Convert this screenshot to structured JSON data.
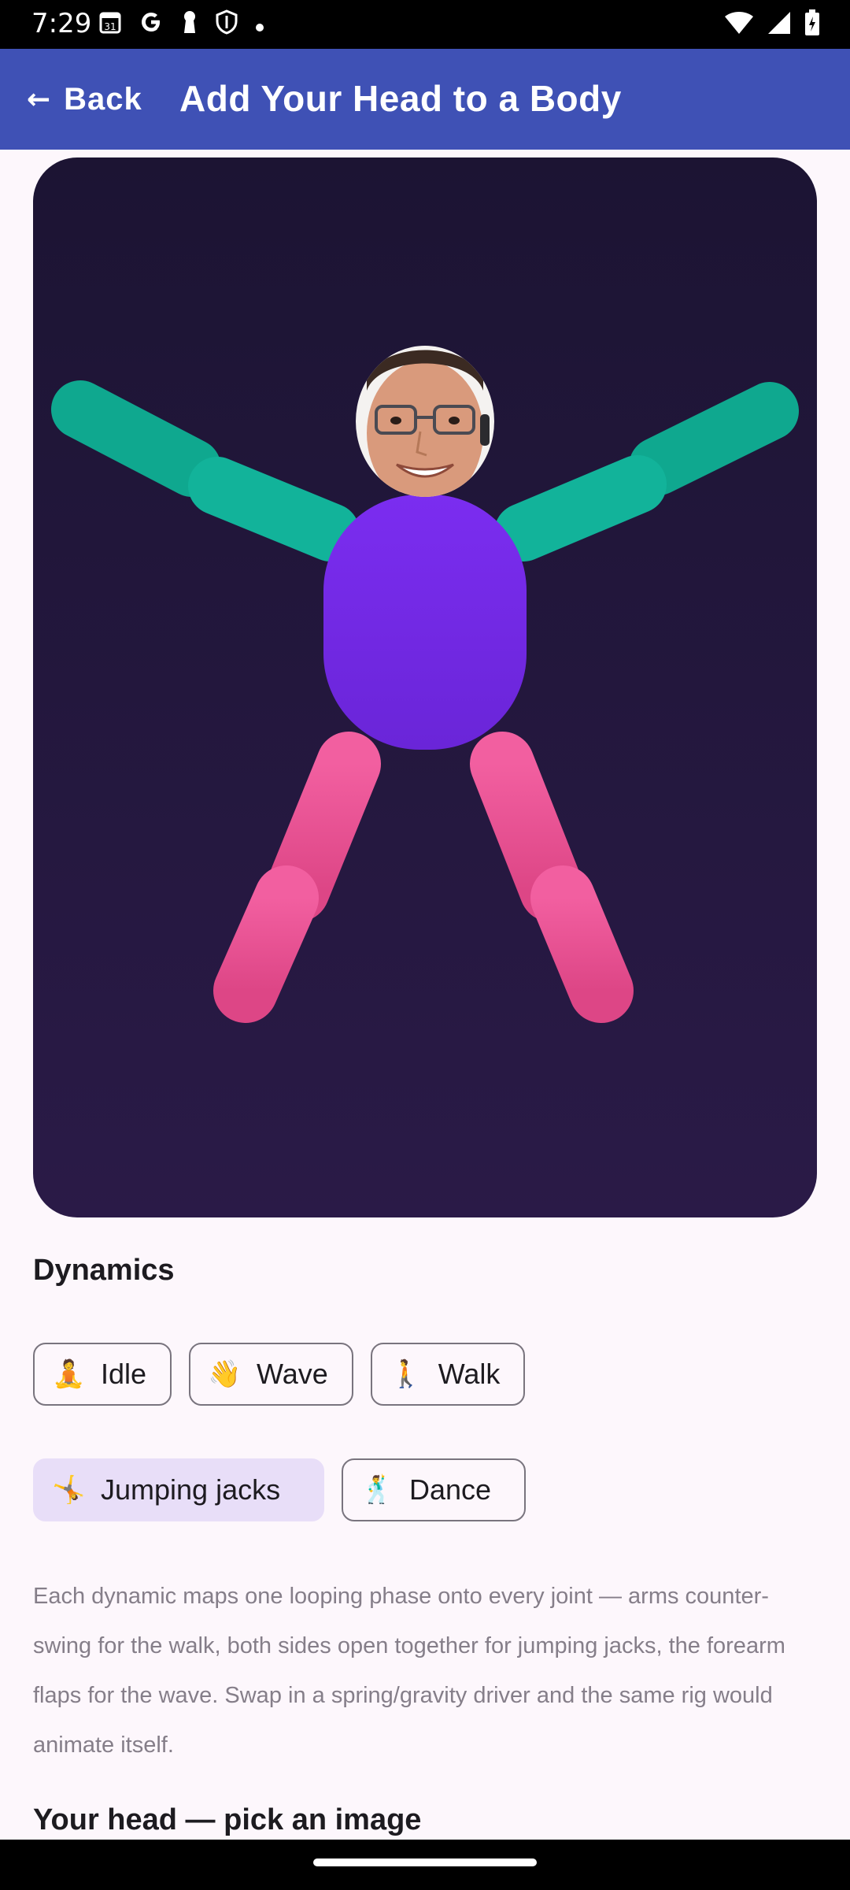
{
  "status_bar": {
    "time": "7:29",
    "left_icons": [
      "calendar-icon",
      "google-icon",
      "keyhole-icon",
      "shield-icon",
      "dot-icon"
    ],
    "right_icons": [
      "wifi-icon",
      "signal-icon",
      "battery-icon"
    ]
  },
  "app_bar": {
    "back_label": "Back",
    "title": "Add Your Head to a Body",
    "background": "#3f51b5"
  },
  "stage": {
    "background": [
      "#1c1433",
      "#2a1a47"
    ],
    "arm_color": "#12b39a",
    "torso_color": "#7b2df0",
    "leg_color": "#ea4c91",
    "head": "user-photo"
  },
  "dynamics": {
    "title": "Dynamics",
    "chips": [
      {
        "emoji": "🧘",
        "label": "Idle",
        "selected": false
      },
      {
        "emoji": "👋",
        "label": "Wave",
        "selected": false
      },
      {
        "emoji": "🚶",
        "label": "Walk",
        "selected": false
      },
      {
        "emoji": "🤸",
        "label": "Jumping jacks",
        "selected": true
      },
      {
        "emoji": "🕺",
        "label": "Dance",
        "selected": false
      }
    ],
    "selected_color": "#e8def8",
    "description": "Each dynamic maps one looping phase onto every joint — arms counter-swing for the walk, both sides open together for jumping jacks, the forearm flaps for the wave. Swap in a spring/gravity driver and the same rig would animate itself."
  },
  "head_section": {
    "title": "Your head — pick an image"
  }
}
